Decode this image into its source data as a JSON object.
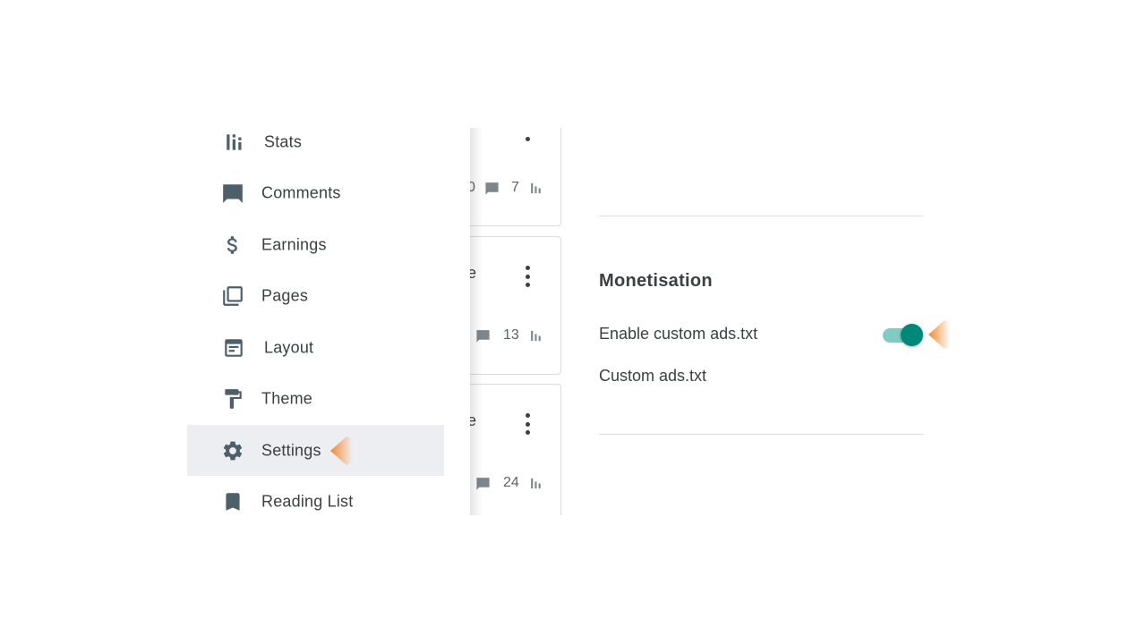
{
  "nav": {
    "items": [
      {
        "label": "Stats",
        "icon": "stats-icon"
      },
      {
        "label": "Comments",
        "icon": "comment-icon"
      },
      {
        "label": "Earnings",
        "icon": "dollar-icon"
      },
      {
        "label": "Pages",
        "icon": "pages-icon"
      },
      {
        "label": "Layout",
        "icon": "layout-icon"
      },
      {
        "label": "Theme",
        "icon": "paint-roller-icon"
      },
      {
        "label": "Settings",
        "icon": "gear-icon",
        "active": true
      },
      {
        "label": "Reading List",
        "icon": "bookmark-icon"
      }
    ]
  },
  "posts": [
    {
      "title_fragment": "",
      "comments_fragment": "0",
      "views": "7"
    },
    {
      "title_fragment": "e",
      "comments_fragment": "",
      "views": "13"
    },
    {
      "title_fragment": "e",
      "comments_fragment": "",
      "views": "24"
    }
  ],
  "settings": {
    "section_title": "Monetisation",
    "enable_custom_ads_label": "Enable custom ads.txt",
    "enable_custom_ads_value": true,
    "custom_ads_label": "Custom ads.txt"
  },
  "colors": {
    "accent": "#00897b",
    "accent_track": "#80cbc4",
    "active_nav_bg": "#eceef1",
    "pointer": "#f5862b"
  }
}
